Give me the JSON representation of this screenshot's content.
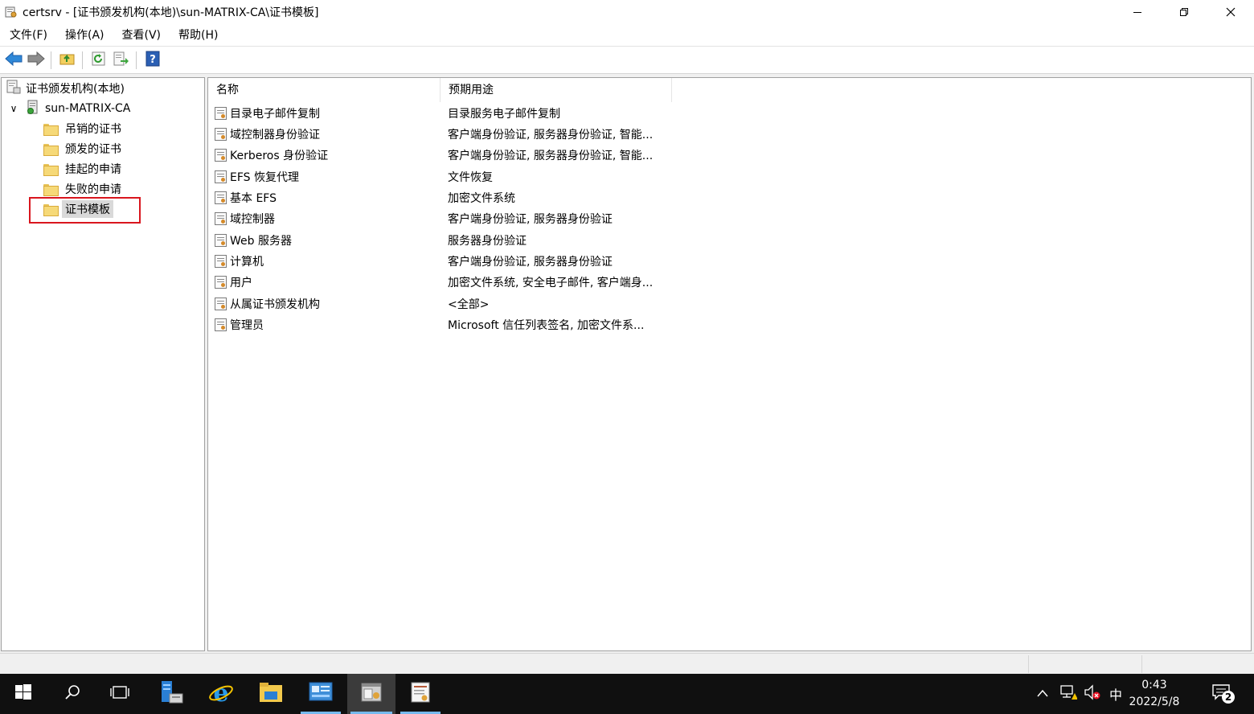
{
  "window": {
    "title": "certsrv - [证书颁发机构(本地)\\sun-MATRIX-CA\\证书模板]",
    "minimize_glyph": "—",
    "maximize_glyph": "❐",
    "close_glyph": "✕"
  },
  "menu": [
    {
      "label": "文件(F)"
    },
    {
      "label": "操作(A)"
    },
    {
      "label": "查看(V)"
    },
    {
      "label": "帮助(H)"
    }
  ],
  "toolbar": {
    "icons": [
      "back-arrow-icon",
      "forward-arrow-icon",
      "up-folder-icon",
      "refresh-icon",
      "export-list-icon",
      "help-icon"
    ]
  },
  "tree": {
    "root": "证书颁发机构(本地)",
    "ca": "sun-MATRIX-CA",
    "expand_glyph": "∨",
    "children": [
      {
        "label": "吊销的证书"
      },
      {
        "label": "颁发的证书"
      },
      {
        "label": "挂起的申请"
      },
      {
        "label": "失败的申请"
      },
      {
        "label": "证书模板"
      }
    ],
    "selected": "证书模板"
  },
  "list": {
    "columns": [
      "名称",
      "预期用途"
    ],
    "rows": [
      {
        "name": "目录电子邮件复制",
        "purpose": "目录服务电子邮件复制"
      },
      {
        "name": "域控制器身份验证",
        "purpose": "客户端身份验证, 服务器身份验证, 智能..."
      },
      {
        "name": "Kerberos 身份验证",
        "purpose": "客户端身份验证, 服务器身份验证, 智能..."
      },
      {
        "name": "EFS 恢复代理",
        "purpose": "文件恢复"
      },
      {
        "name": "基本 EFS",
        "purpose": "加密文件系统"
      },
      {
        "name": "域控制器",
        "purpose": "客户端身份验证, 服务器身份验证"
      },
      {
        "name": "Web 服务器",
        "purpose": "服务器身份验证"
      },
      {
        "name": "计算机",
        "purpose": "客户端身份验证, 服务器身份验证"
      },
      {
        "name": "用户",
        "purpose": "加密文件系统, 安全电子邮件, 客户端身..."
      },
      {
        "name": "从属证书颁发机构",
        "purpose": "<全部>"
      },
      {
        "name": "管理员",
        "purpose": "Microsoft 信任列表签名, 加密文件系..."
      }
    ]
  },
  "taskbar": {
    "apps": [
      "start-icon",
      "search-icon",
      "task-view-icon",
      "server-manager-icon",
      "internet-explorer-icon",
      "file-explorer-icon",
      "control-panel-icon",
      "certsrv-icon",
      "certificate-templates-icon"
    ],
    "tray": {
      "chevron_glyph": "^",
      "ime": "中",
      "time": "0:43",
      "date": "2022/5/8",
      "notification_count": "2"
    }
  },
  "colors": {
    "highlight_box": "#d9161e",
    "taskbar": "#101010",
    "running_indicator": "#76b9ed"
  }
}
